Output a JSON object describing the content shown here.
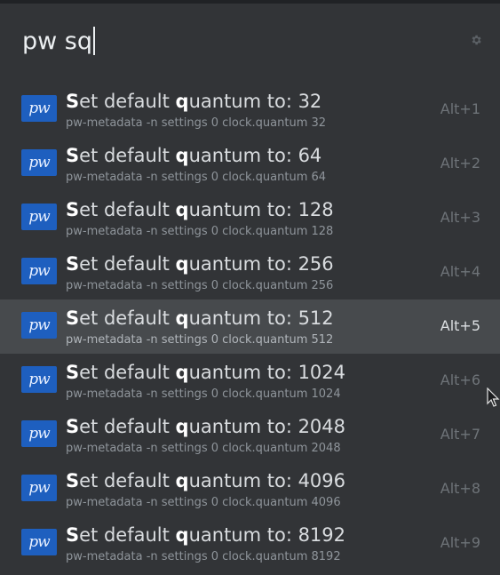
{
  "search": {
    "query": "pw sq"
  },
  "results": [
    {
      "title_prefix": "S",
      "title_mid1": "et default ",
      "title_hl": "q",
      "title_rest": "uantum to: 32",
      "subtitle": "pw-metadata -n settings 0 clock.quantum 32",
      "shortcut": "Alt+1",
      "icon_text": "pw"
    },
    {
      "title_prefix": "S",
      "title_mid1": "et default ",
      "title_hl": "q",
      "title_rest": "uantum to: 64",
      "subtitle": "pw-metadata -n settings 0 clock.quantum 64",
      "shortcut": "Alt+2",
      "icon_text": "pw"
    },
    {
      "title_prefix": "S",
      "title_mid1": "et default ",
      "title_hl": "q",
      "title_rest": "uantum to: 128",
      "subtitle": "pw-metadata -n settings 0 clock.quantum 128",
      "shortcut": "Alt+3",
      "icon_text": "pw"
    },
    {
      "title_prefix": "S",
      "title_mid1": "et default ",
      "title_hl": "q",
      "title_rest": "uantum to: 256",
      "subtitle": "pw-metadata -n settings 0 clock.quantum 256",
      "shortcut": "Alt+4",
      "icon_text": "pw"
    },
    {
      "title_prefix": "S",
      "title_mid1": "et default ",
      "title_hl": "q",
      "title_rest": "uantum to: 512",
      "subtitle": "pw-metadata -n settings 0 clock.quantum 512",
      "shortcut": "Alt+5",
      "icon_text": "pw"
    },
    {
      "title_prefix": "S",
      "title_mid1": "et default ",
      "title_hl": "q",
      "title_rest": "uantum to: 1024",
      "subtitle": "pw-metadata -n settings 0 clock.quantum 1024",
      "shortcut": "Alt+6",
      "icon_text": "pw"
    },
    {
      "title_prefix": "S",
      "title_mid1": "et default ",
      "title_hl": "q",
      "title_rest": "uantum to: 2048",
      "subtitle": "pw-metadata -n settings 0 clock.quantum 2048",
      "shortcut": "Alt+7",
      "icon_text": "pw"
    },
    {
      "title_prefix": "S",
      "title_mid1": "et default ",
      "title_hl": "q",
      "title_rest": "uantum to: 4096",
      "subtitle": "pw-metadata -n settings 0 clock.quantum 4096",
      "shortcut": "Alt+8",
      "icon_text": "pw"
    },
    {
      "title_prefix": "S",
      "title_mid1": "et default ",
      "title_hl": "q",
      "title_rest": "uantum to: 8192",
      "subtitle": "pw-metadata -n settings 0 clock.quantum 8192",
      "shortcut": "Alt+9",
      "icon_text": "pw"
    }
  ],
  "selected_index": 4,
  "colors": {
    "background": "#323437",
    "selected_row": "#474a4d",
    "icon_blue": "#1e5fbf"
  },
  "icons": {
    "settings": "gear-icon",
    "app": "pipewire-app-icon",
    "cursor": "mouse-pointer-icon"
  }
}
